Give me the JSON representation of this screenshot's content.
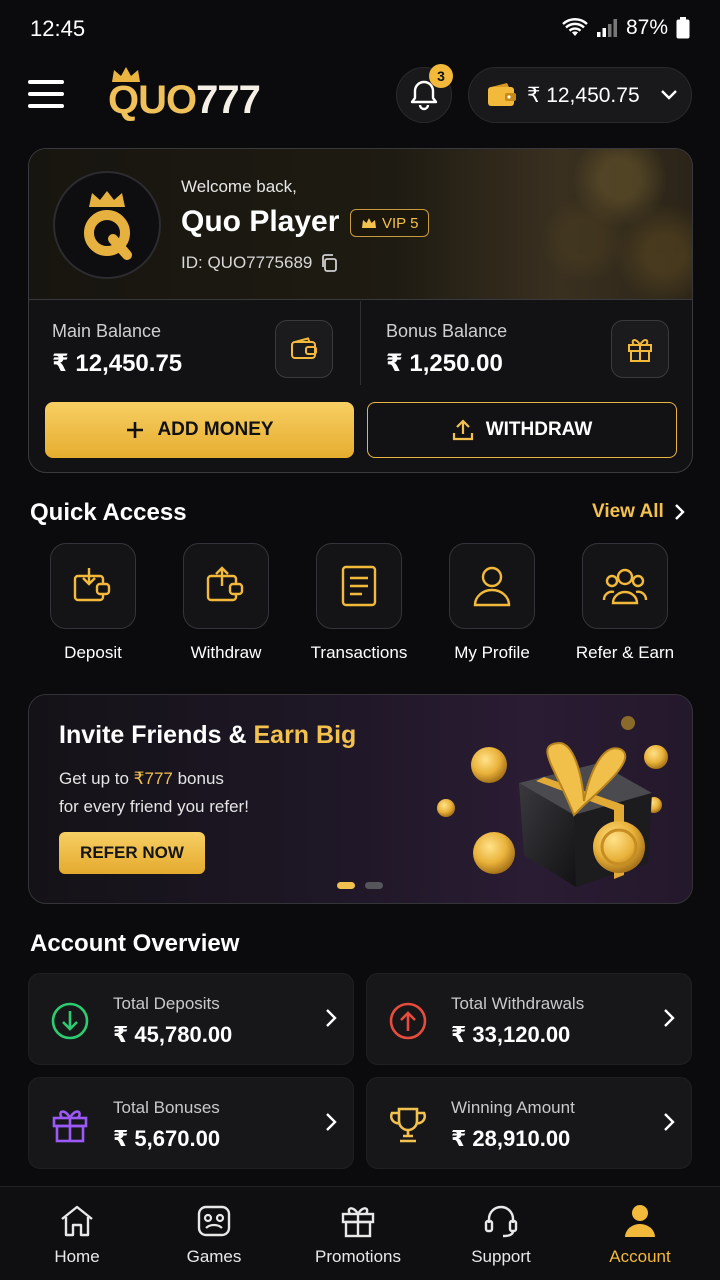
{
  "status_bar": {
    "time": "12:45",
    "battery": "87%"
  },
  "header": {
    "logo_prefix": "QUO",
    "logo_suffix": "777",
    "notifications_count": "3",
    "wallet_balance": "₹ 12,450.75"
  },
  "profile": {
    "welcome": "Welcome back,",
    "name": "Quo Player",
    "vip": "VIP 5",
    "id": "ID: QUO7775689",
    "main_balance_label": "Main Balance",
    "main_balance_value": "₹ 12,450.75",
    "bonus_balance_label": "Bonus Balance",
    "bonus_balance_value": "₹ 1,250.00",
    "add_money_label": "ADD MONEY",
    "withdraw_label": "WITHDRAW"
  },
  "quick_access": {
    "title": "Quick Access",
    "view_all": "View All",
    "items": [
      {
        "label": "Deposit",
        "icon": "deposit-icon"
      },
      {
        "label": "Withdraw",
        "icon": "withdraw-icon"
      },
      {
        "label": "Transactions",
        "icon": "transactions-icon"
      },
      {
        "label": "My Profile",
        "icon": "user-icon"
      },
      {
        "label": "Refer & Earn",
        "icon": "users-icon"
      }
    ]
  },
  "promo": {
    "title_white": "Invite Friends & ",
    "title_gold": "Earn Big",
    "line1_prefix": "Get up to ",
    "line1_amount": "₹777",
    "line1_suffix": " bonus",
    "line2": "for every friend you refer!",
    "button": "REFER NOW",
    "slide_count": 2,
    "active_slide": 1
  },
  "overview": {
    "title": "Account Overview",
    "cards": [
      {
        "label": "Total Deposits",
        "value": "₹ 45,780.00",
        "icon": "arrow-down-circle-icon",
        "color": "#2ecc71"
      },
      {
        "label": "Total Withdrawals",
        "value": "₹ 33,120.00",
        "icon": "arrow-up-circle-icon",
        "color": "#e74c3c"
      },
      {
        "label": "Total Bonuses",
        "value": "₹ 5,670.00",
        "icon": "gift-icon",
        "color": "#9b59f6"
      },
      {
        "label": "Winning Amount",
        "value": "₹ 28,910.00",
        "icon": "trophy-icon",
        "color": "#f2c14e"
      }
    ]
  },
  "nav": {
    "items": [
      {
        "label": "Home",
        "icon": "home-icon"
      },
      {
        "label": "Games",
        "icon": "gamepad-icon"
      },
      {
        "label": "Promotions",
        "icon": "gift-icon"
      },
      {
        "label": "Support",
        "icon": "headset-icon"
      },
      {
        "label": "Account",
        "icon": "user-icon"
      }
    ],
    "active": "Account"
  },
  "colors": {
    "accent": "#f2c14e",
    "background": "#0b0b0d",
    "card": "#17171a"
  }
}
